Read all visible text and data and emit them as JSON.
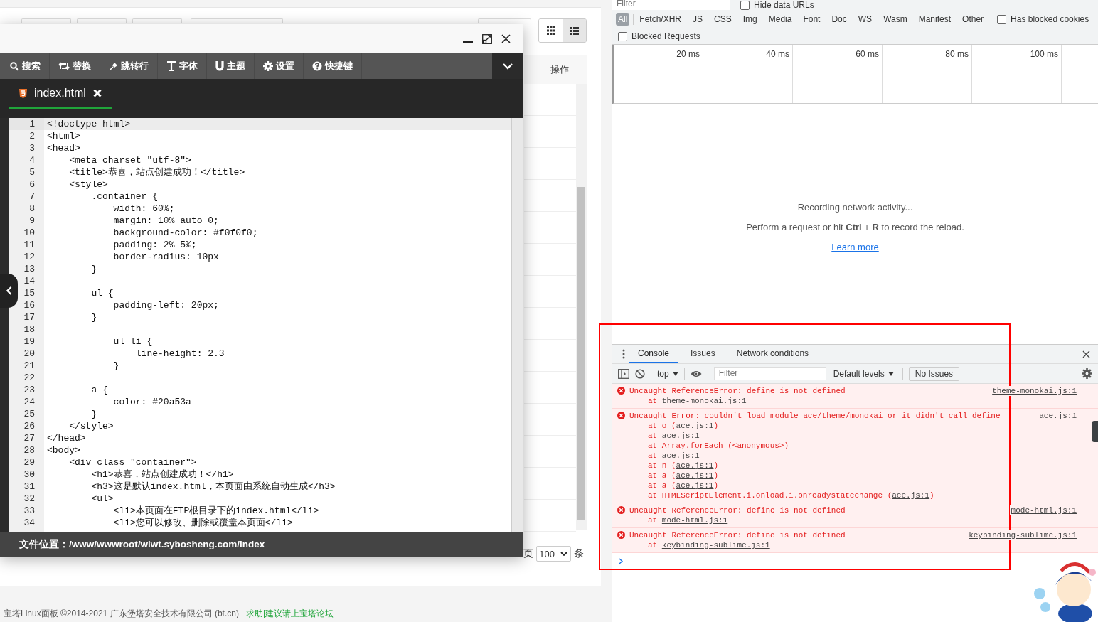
{
  "page": {
    "view_toggles": [
      {
        "selected": false
      },
      {
        "selected": true
      }
    ],
    "column_header": "操作",
    "pagination": {
      "page_label": "页",
      "page_size": "100",
      "unit": "条"
    },
    "footer": {
      "text": "宝塔Linux面板 ©2014-2021 广东堡塔安全技术有限公司 (bt.cn)",
      "link": "求助|建议请上宝塔论坛"
    }
  },
  "editor": {
    "toolbar": [
      {
        "label": "搜索"
      },
      {
        "label": "替换"
      },
      {
        "label": "跳转行"
      },
      {
        "label": "字体"
      },
      {
        "label": "主题"
      },
      {
        "label": "设置"
      },
      {
        "label": "快捷键"
      }
    ],
    "tabs": [
      {
        "label": "index.html",
        "selected": true
      }
    ],
    "lines": [
      {
        "n": "1",
        "code": "<!doctype html>",
        "active": true
      },
      {
        "n": "2",
        "code": "<html>",
        "active": false
      },
      {
        "n": "3",
        "code": "<head>",
        "active": false
      },
      {
        "n": "4",
        "code": "    <meta charset=\"utf-8\">",
        "active": false
      },
      {
        "n": "5",
        "code": "    <title>恭喜，站点创建成功！</title>",
        "active": false
      },
      {
        "n": "6",
        "code": "    <style>",
        "active": false
      },
      {
        "n": "7",
        "code": "        .container {",
        "active": false
      },
      {
        "n": "8",
        "code": "            width: 60%;",
        "active": false
      },
      {
        "n": "9",
        "code": "            margin: 10% auto 0;",
        "active": false
      },
      {
        "n": "10",
        "code": "            background-color: #f0f0f0;",
        "active": false
      },
      {
        "n": "11",
        "code": "            padding: 2% 5%;",
        "active": false
      },
      {
        "n": "12",
        "code": "            border-radius: 10px",
        "active": false
      },
      {
        "n": "13",
        "code": "        }",
        "active": false
      },
      {
        "n": "14",
        "active": false
      },
      {
        "n": "15",
        "code": "        ul {",
        "active": false
      },
      {
        "n": "16",
        "code": "            padding-left: 20px;",
        "active": false
      },
      {
        "n": "17",
        "code": "        }",
        "active": false
      },
      {
        "n": "18",
        "active": false
      },
      {
        "n": "19",
        "code": "            ul li {",
        "active": false
      },
      {
        "n": "20",
        "code": "                line-height: 2.3",
        "active": false
      },
      {
        "n": "21",
        "code": "            }",
        "active": false
      },
      {
        "n": "22",
        "active": false
      },
      {
        "n": "23",
        "code": "        a {",
        "active": false
      },
      {
        "n": "24",
        "code": "            color: #20a53a",
        "active": false
      },
      {
        "n": "25",
        "code": "        }",
        "active": false
      },
      {
        "n": "26",
        "code": "    </style>",
        "active": false
      },
      {
        "n": "27",
        "code": "</head>",
        "active": false
      },
      {
        "n": "28",
        "code": "<body>",
        "active": false
      },
      {
        "n": "29",
        "code": "    <div class=\"container\">",
        "active": false
      },
      {
        "n": "30",
        "code": "        <h1>恭喜，站点创建成功！</h1>",
        "active": false
      },
      {
        "n": "31",
        "code": "        <h3>这是默认index.html，本页面由系统自动生成</h3>",
        "active": false
      },
      {
        "n": "32",
        "code": "        <ul>",
        "active": false
      },
      {
        "n": "33",
        "code": "            <li>本页面在FTP根目录下的index.html</li>",
        "active": false
      },
      {
        "n": "34",
        "code": "            <li>您可以修改、删除或覆盖本页面</li>",
        "active": false
      }
    ],
    "file_path": "文件位置：/www/wwwroot/wlwt.sybosheng.com/index"
  },
  "devtools": {
    "filter_placeholder": "Filter",
    "hide_data_urls": {
      "label": "Hide data URLs",
      "checked": false
    },
    "types": [
      {
        "label": "All",
        "selected": true
      },
      {
        "label": "Fetch/XHR",
        "selected": false
      },
      {
        "label": "JS",
        "selected": false
      },
      {
        "label": "CSS",
        "selected": false
      },
      {
        "label": "Img",
        "selected": false
      },
      {
        "label": "Media",
        "selected": false
      },
      {
        "label": "Font",
        "selected": false
      },
      {
        "label": "Doc",
        "selected": false
      },
      {
        "label": "WS",
        "selected": false
      },
      {
        "label": "Wasm",
        "selected": false
      },
      {
        "label": "Manifest",
        "selected": false
      },
      {
        "label": "Other",
        "selected": false
      }
    ],
    "has_blocked_cookies": {
      "label": "Has blocked cookies",
      "checked": false
    },
    "blocked_requests": {
      "label": "Blocked Requests",
      "checked": false
    },
    "ticks": [
      "20 ms",
      "40 ms",
      "60 ms",
      "80 ms",
      "100 ms"
    ],
    "empty": {
      "title": "Recording network activity...",
      "hint": "Perform a request or hit **Ctrl** + **R** to record the reload.",
      "link": "Learn more"
    },
    "drawer": {
      "tabs": [
        {
          "label": "Console",
          "selected": true
        },
        {
          "label": "Issues",
          "selected": false
        },
        {
          "label": "Network conditions",
          "selected": false
        }
      ],
      "context": "top",
      "filter_placeholder": "Filter",
      "levels": "Default levels",
      "issues": "No Issues",
      "messages": [
        {
          "text": "Uncaught ReferenceError: define is not defined",
          "source": "theme-monokai.js:1",
          "stack": [
            {
              "pre": "at ",
              "link": "theme-monokai.js:1"
            }
          ]
        },
        {
          "text": "Uncaught Error: couldn't load module ace/theme/monokai or it didn't call define",
          "source": "ace.js:1",
          "stack": [
            {
              "pre": "at o (",
              "link": "ace.js:1",
              "post": ")"
            },
            {
              "pre": "at ",
              "link": "ace.js:1"
            },
            {
              "pre": "at Array.forEach (<anonymous>)"
            },
            {
              "pre": "at ",
              "link": "ace.js:1"
            },
            {
              "pre": "at n (",
              "link": "ace.js:1",
              "post": ")"
            },
            {
              "pre": "at a (",
              "link": "ace.js:1",
              "post": ")"
            },
            {
              "pre": "at a (",
              "link": "ace.js:1",
              "post": ")"
            },
            {
              "pre": "at HTMLScriptElement.i.onload.i.onreadystatechange (",
              "link": "ace.js:1",
              "post": ")"
            }
          ]
        },
        {
          "text": "Uncaught ReferenceError: define is not defined",
          "source": "mode-html.js:1",
          "stack": [
            {
              "pre": "at ",
              "link": "mode-html.js:1"
            }
          ]
        },
        {
          "text": "Uncaught ReferenceError: define is not defined",
          "source": "keybinding-sublime.js:1",
          "stack": [
            {
              "pre": "at ",
              "link": "keybinding-sublime.js:1"
            }
          ]
        }
      ]
    }
  }
}
